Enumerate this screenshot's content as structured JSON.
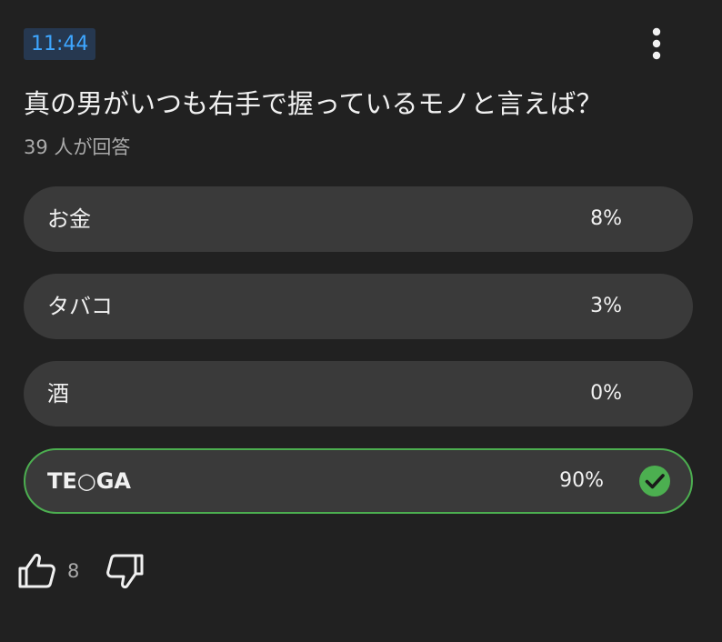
{
  "post": {
    "timestamp": "11:44",
    "question": "真の男がいつも右手で握っているモノと言えば？",
    "answer_count": "39 人が回答"
  },
  "options": [
    {
      "label": "お金",
      "percent": "8%",
      "selected": false
    },
    {
      "label": "タバコ",
      "percent": "3%",
      "selected": false
    },
    {
      "label": "酒",
      "percent": "0%",
      "selected": false
    },
    {
      "label": "TE○GA",
      "percent": "90%",
      "selected": true
    }
  ],
  "actions": {
    "like_count": "8",
    "like_icon": "thumbs-up-icon",
    "dislike_icon": "thumbs-down-icon",
    "menu_icon": "more-vertical-icon"
  },
  "colors": {
    "background": "#212121",
    "option_bg": "#3a3a3a",
    "selected_border": "#4caf50",
    "timestamp_bg": "#263850",
    "timestamp_text": "#3ea6ff"
  }
}
